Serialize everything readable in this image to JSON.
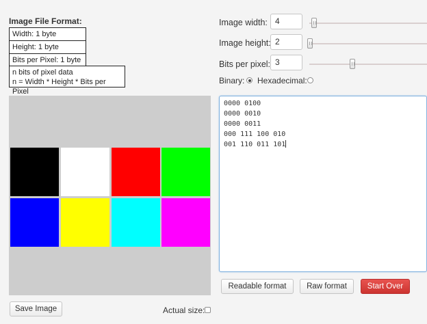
{
  "format": {
    "title": "Image File Format:",
    "width_line": "Width: 1 byte",
    "height_line": "Height: 1 byte",
    "bpp_line": "Bits per Pixel: 1 byte",
    "pixel_line1": "n bits of pixel data",
    "pixel_line2": "n = Width * Height * Bits per Pixel"
  },
  "pixels": [
    "#000000",
    "#ffffff",
    "#ff0000",
    "#00ff00",
    "#0000ff",
    "#ffff00",
    "#00ffff",
    "#ff00ff"
  ],
  "controls": {
    "width_label": "Image width:",
    "width_value": "4",
    "height_label": "Image height:",
    "height_value": "2",
    "bpp_label": "Bits per pixel:",
    "bpp_value": "3",
    "binary_label": "Binary:",
    "hex_label": "Hexadecimal:"
  },
  "output_lines": [
    "0000 0100",
    "0000 0010",
    "0000 0011",
    "000 111 100 010",
    "001 110 011 101"
  ],
  "buttons": {
    "readable": "Readable format",
    "raw": "Raw format",
    "start_over": "Start Over",
    "save": "Save Image"
  },
  "actual_size_label": "Actual size:"
}
